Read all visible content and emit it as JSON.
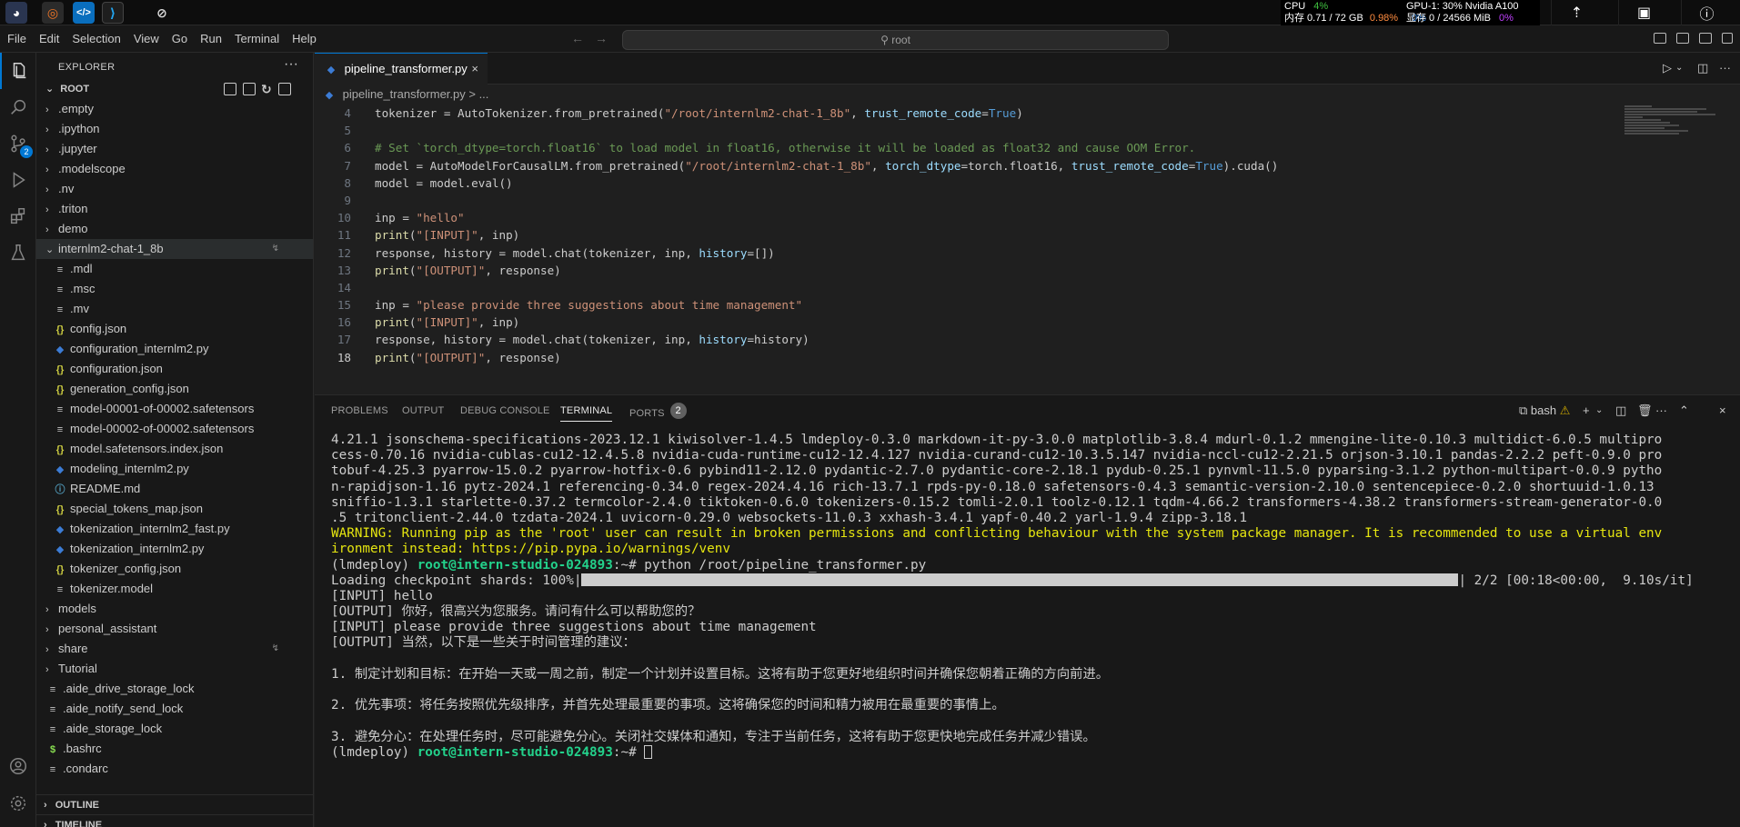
{
  "menubar": {
    "items": [
      "File",
      "Edit",
      "Selection",
      "View",
      "Go",
      "Run",
      "Terminal",
      "Help"
    ],
    "search": "root"
  },
  "system": {
    "cpu_label": "CPU",
    "cpu_value": "4%",
    "mem_label": "内存 0.71 / 72 GB",
    "mem_value": "0.98%",
    "gpu_label": "GPU-1: 30% Nvidia A100",
    "gpu_value": "0%",
    "vram_label": "显存 0 / 24566 MiB",
    "vram_value": "0%"
  },
  "activity": {
    "source_control_badge": "2"
  },
  "sidebar": {
    "title": "EXPLORER",
    "root_label": "ROOT",
    "items": [
      {
        "label": ".empty",
        "type": "folder",
        "depth": 0
      },
      {
        "label": ".ipython",
        "type": "folder",
        "depth": 0
      },
      {
        "label": ".jupyter",
        "type": "folder",
        "depth": 0
      },
      {
        "label": ".modelscope",
        "type": "folder",
        "depth": 0
      },
      {
        "label": ".nv",
        "type": "folder",
        "depth": 0
      },
      {
        "label": ".triton",
        "type": "folder",
        "depth": 0
      },
      {
        "label": "demo",
        "type": "folder",
        "depth": 0
      },
      {
        "label": "internlm2-chat-1_8b",
        "type": "folder-open",
        "depth": 0
      },
      {
        "label": ".mdl",
        "type": "txt",
        "depth": 1
      },
      {
        "label": ".msc",
        "type": "txt",
        "depth": 1
      },
      {
        "label": ".mv",
        "type": "txt",
        "depth": 1
      },
      {
        "label": "config.json",
        "type": "json",
        "depth": 1
      },
      {
        "label": "configuration_internlm2.py",
        "type": "py",
        "depth": 1
      },
      {
        "label": "configuration.json",
        "type": "json",
        "depth": 1
      },
      {
        "label": "generation_config.json",
        "type": "json",
        "depth": 1
      },
      {
        "label": "model-00001-of-00002.safetensors",
        "type": "txt",
        "depth": 1
      },
      {
        "label": "model-00002-of-00002.safetensors",
        "type": "txt",
        "depth": 1
      },
      {
        "label": "model.safetensors.index.json",
        "type": "json",
        "depth": 1
      },
      {
        "label": "modeling_internlm2.py",
        "type": "py",
        "depth": 1
      },
      {
        "label": "README.md",
        "type": "md",
        "depth": 1
      },
      {
        "label": "special_tokens_map.json",
        "type": "json",
        "depth": 1
      },
      {
        "label": "tokenization_internlm2_fast.py",
        "type": "py",
        "depth": 1
      },
      {
        "label": "tokenization_internlm2.py",
        "type": "py",
        "depth": 1
      },
      {
        "label": "tokenizer_config.json",
        "type": "json",
        "depth": 1
      },
      {
        "label": "tokenizer.model",
        "type": "txt",
        "depth": 1
      },
      {
        "label": "models",
        "type": "folder",
        "depth": 0
      },
      {
        "label": "personal_assistant",
        "type": "folder",
        "depth": 0
      },
      {
        "label": "share",
        "type": "folder",
        "depth": 0
      },
      {
        "label": "Tutorial",
        "type": "folder",
        "depth": 0
      },
      {
        "label": ".aide_drive_storage_lock",
        "type": "txt",
        "depth": 0
      },
      {
        "label": ".aide_notify_send_lock",
        "type": "txt",
        "depth": 0
      },
      {
        "label": ".aide_storage_lock",
        "type": "txt",
        "depth": 0
      },
      {
        "label": ".bashrc",
        "type": "sh",
        "depth": 0
      },
      {
        "label": ".condarc",
        "type": "txt",
        "depth": 0
      }
    ],
    "outline_label": "OUTLINE",
    "timeline_label": "TIMELINE"
  },
  "editor": {
    "tab_label": "pipeline_transformer.py",
    "breadcrumb": "pipeline_transformer.py > ...",
    "lines": [
      {
        "n": "4",
        "html": "tokenizer = AutoTokenizer.from_pretrained(<span class='c-str'>\"/root/internlm2-chat-1_8b\"</span>, <span class='c-var'>trust_remote_code</span>=<span class='c-kw'>True</span>)"
      },
      {
        "n": "5",
        "html": ""
      },
      {
        "n": "6",
        "html": "<span class='c-cmt'># Set `torch_dtype=torch.float16` to load model in float16, otherwise it will be loaded as float32 and cause OOM Error.</span>"
      },
      {
        "n": "7",
        "html": "model = AutoModelForCausalLM.from_pretrained(<span class='c-str'>\"/root/internlm2-chat-1_8b\"</span>, <span class='c-var'>torch_dtype</span>=torch.float16, <span class='c-var'>trust_remote_code</span>=<span class='c-kw'>True</span>).cuda()"
      },
      {
        "n": "8",
        "html": "model = model.eval()"
      },
      {
        "n": "9",
        "html": ""
      },
      {
        "n": "10",
        "html": "inp = <span class='c-str'>\"hello\"</span>"
      },
      {
        "n": "11",
        "html": "<span class='c-fn'>print</span>(<span class='c-str'>\"[INPUT]\"</span>, inp)"
      },
      {
        "n": "12",
        "html": "response, history = model.chat(tokenizer, inp, <span class='c-var'>history</span>=[])"
      },
      {
        "n": "13",
        "html": "<span class='c-fn'>print</span>(<span class='c-str'>\"[OUTPUT]\"</span>, response)"
      },
      {
        "n": "14",
        "html": ""
      },
      {
        "n": "15",
        "html": "inp = <span class='c-str'>\"please provide three suggestions about time management\"</span>"
      },
      {
        "n": "16",
        "html": "<span class='c-fn'>print</span>(<span class='c-str'>\"[INPUT]\"</span>, inp)"
      },
      {
        "n": "17",
        "html": "response, history = model.chat(tokenizer, inp, <span class='c-var'>history</span>=history)"
      },
      {
        "n": "18",
        "html": "<span class='c-fn'>print</span>(<span class='c-str'>\"[OUTPUT]\"</span>, response)"
      }
    ]
  },
  "panel": {
    "tabs": [
      "PROBLEMS",
      "OUTPUT",
      "DEBUG CONSOLE",
      "TERMINAL",
      "PORTS"
    ],
    "ports_badge": "2",
    "shell_label": "bash",
    "terminal": {
      "lines_before": [
        {
          "cls": "",
          "text": "4.21.1 jsonschema-specifications-2023.12.1 kiwisolver-1.4.5 lmdeploy-0.3.0 markdown-it-py-3.0.0 matplotlib-3.8.4 mdurl-0.1.2 mmengine-lite-0.10.3 multidict-6.0.5 multipro"
        },
        {
          "cls": "",
          "text": "cess-0.70.16 nvidia-cublas-cu12-12.4.5.8 nvidia-cuda-runtime-cu12-12.4.127 nvidia-curand-cu12-10.3.5.147 nvidia-nccl-cu12-2.21.5 orjson-3.10.1 pandas-2.2.2 peft-0.9.0 pro"
        },
        {
          "cls": "",
          "text": "tobuf-4.25.3 pyarrow-15.0.2 pyarrow-hotfix-0.6 pybind11-2.12.0 pydantic-2.7.0 pydantic-core-2.18.1 pydub-0.25.1 pynvml-11.5.0 pyparsing-3.1.2 python-multipart-0.0.9 pytho"
        },
        {
          "cls": "",
          "text": "n-rapidjson-1.16 pytz-2024.1 referencing-0.34.0 regex-2024.4.16 rich-13.7.1 rpds-py-0.18.0 safetensors-0.4.3 semantic-version-2.10.0 sentencepiece-0.2.0 shortuuid-1.0.13"
        },
        {
          "cls": "",
          "text": "sniffio-1.3.1 starlette-0.37.2 termcolor-2.4.0 tiktoken-0.6.0 tokenizers-0.15.2 tomli-2.0.1 toolz-0.12.1 tqdm-4.66.2 transformers-4.38.2 transformers-stream-generator-0.0"
        },
        {
          "cls": "",
          "text": ".5 tritonclient-2.44.0 tzdata-2024.1 uvicorn-0.29.0 websockets-11.0.3 xxhash-3.4.1 yapf-0.40.2 yarl-1.9.4 zipp-3.18.1"
        },
        {
          "cls": "t-warn",
          "text": "WARNING: Running pip as the 'root' user can result in broken permissions and conflicting behaviour with the system package manager. It is recommended to use a virtual env"
        },
        {
          "cls": "t-warn",
          "text": "ironment instead: https://pip.pypa.io/warnings/venv"
        }
      ],
      "prompt_env": "(lmdeploy) ",
      "prompt_user": "root@intern-studio-024893",
      "prompt_cmd": ":~# python /root/pipeline_transformer.py",
      "progress_prefix": "Loading checkpoint shards: 100%|",
      "progress_fraction": 1.0,
      "progress_suffix": "| 2/2 [00:18<00:00,  9.10s/it]",
      "lines_after": [
        "[INPUT] hello",
        "[OUTPUT] 你好，很高兴为您服务。请问有什么可以帮助您的？",
        "[INPUT] please provide three suggestions about time management",
        "[OUTPUT] 当然，以下是一些关于时间管理的建议：",
        "",
        "1. 制定计划和目标：在开始一天或一周之前，制定一个计划并设置目标。这将有助于您更好地组织时间并确保您朝着正确的方向前进。",
        "",
        "2. 优先事项：将任务按照优先级排序，并首先处理最重要的事项。这将确保您的时间和精力被用在最重要的事情上。",
        "",
        "3. 避免分心：在处理任务时，尽可能避免分心。关闭社交媒体和通知，专注于当前任务，这将有助于您更快地完成任务并减少错误。"
      ],
      "final_prompt_cmd": ":~# "
    }
  }
}
